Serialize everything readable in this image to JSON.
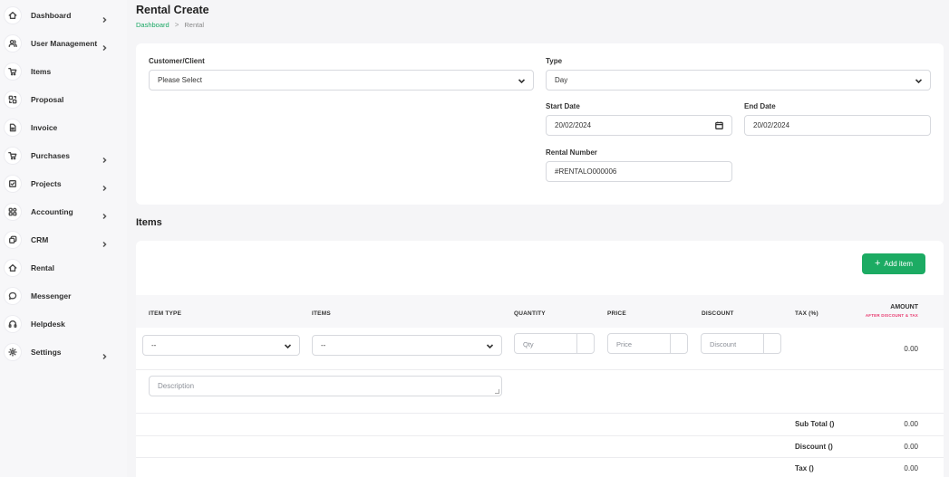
{
  "sidebar": {
    "items": [
      {
        "label": "Dashboard",
        "icon": "home-icon",
        "chevron": true
      },
      {
        "label": "User Management",
        "icon": "users-icon",
        "chevron": true
      },
      {
        "label": "Items",
        "icon": "cart-icon",
        "chevron": false
      },
      {
        "label": "Proposal",
        "icon": "swap-icon",
        "chevron": false
      },
      {
        "label": "Invoice",
        "icon": "file-icon",
        "chevron": false
      },
      {
        "label": "Purchases",
        "icon": "cart-icon",
        "chevron": true
      },
      {
        "label": "Projects",
        "icon": "check-square-icon",
        "chevron": true
      },
      {
        "label": "Accounting",
        "icon": "grid-icon",
        "chevron": true
      },
      {
        "label": "CRM",
        "icon": "layers-icon",
        "chevron": true
      },
      {
        "label": "Rental",
        "icon": "home-icon",
        "chevron": false
      },
      {
        "label": "Messenger",
        "icon": "chat-icon",
        "chevron": false
      },
      {
        "label": "Helpdesk",
        "icon": "headphones-icon",
        "chevron": false
      },
      {
        "label": "Settings",
        "icon": "gear-icon",
        "chevron": true
      }
    ]
  },
  "header": {
    "title": "Rental Create",
    "breadcrumb": [
      "Dashboard",
      "Rental"
    ],
    "breadcrumb_separator": ">"
  },
  "form": {
    "customer": {
      "label": "Customer/Client",
      "value": "Please Select"
    },
    "type": {
      "label": "Type",
      "value": "Day"
    },
    "start_date": {
      "label": "Start Date",
      "value": "20/02/2024"
    },
    "end_date": {
      "label": "End Date",
      "value": "20/02/2024"
    },
    "rental_number": {
      "label": "Rental Number",
      "value": "#RENTALO000006"
    }
  },
  "items_section": {
    "title": "Items",
    "add_button": "Add item",
    "add_button_icon": "+",
    "columns": {
      "item_type": "ITEM TYPE",
      "items": "ITEMS",
      "quantity": "QUANTITY",
      "price": "PRICE",
      "discount": "DISCOUNT",
      "tax": "TAX (%)",
      "amount": "AMOUNT",
      "amount_sub": "AFTER DISCOUNT & TAX"
    },
    "row": {
      "item_type": "--",
      "items": "--",
      "qty_placeholder": "Qty",
      "price_placeholder": "Price",
      "discount_placeholder": "Discount",
      "amount": "0.00",
      "description_placeholder": "Description"
    },
    "summary": [
      {
        "label": "Sub Total ()",
        "value": "0.00"
      },
      {
        "label": "Discount ()",
        "value": "0.00"
      },
      {
        "label": "Tax ()",
        "value": "0.00"
      }
    ]
  },
  "colors": {
    "accent": "#1cab63",
    "amount_note": "#e8386e"
  }
}
